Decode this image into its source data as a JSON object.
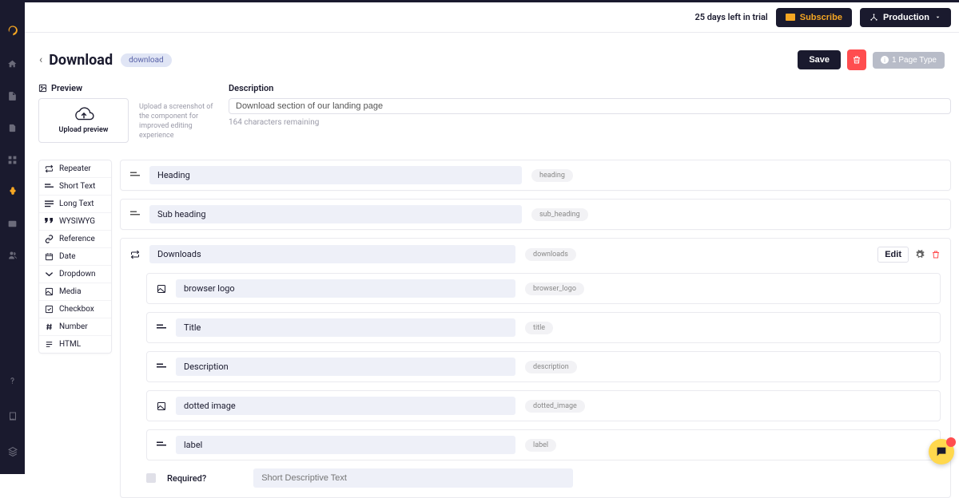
{
  "header": {
    "trial_text": "25 days left in trial",
    "subscribe_label": "Subscribe",
    "env_label": "Production"
  },
  "titlebar": {
    "title": "Download",
    "slug": "download",
    "save_label": "Save",
    "pagetype_label": "1 Page Type"
  },
  "preview": {
    "label": "Preview",
    "upload_text": "Upload preview",
    "hint": "Upload a screenshot of the component for improved editing experience"
  },
  "description_section": {
    "label": "Description",
    "value": "Download section of our landing page",
    "counter": "164 characters remaining"
  },
  "palette": {
    "items": [
      {
        "icon": "repeat",
        "label": "Repeater"
      },
      {
        "icon": "short-text",
        "label": "Short Text"
      },
      {
        "icon": "long-text",
        "label": "Long Text"
      },
      {
        "icon": "quote",
        "label": "WYSIWYG"
      },
      {
        "icon": "link",
        "label": "Reference"
      },
      {
        "icon": "calendar",
        "label": "Date"
      },
      {
        "icon": "chevron-down",
        "label": "Dropdown"
      },
      {
        "icon": "image",
        "label": "Media"
      },
      {
        "icon": "checkbox",
        "label": "Checkbox"
      },
      {
        "icon": "hash",
        "label": "Number"
      },
      {
        "icon": "html",
        "label": "HTML"
      }
    ]
  },
  "fields": {
    "heading": {
      "name": "Heading",
      "tag": "heading"
    },
    "sub_heading": {
      "name": "Sub heading",
      "tag": "sub_heading"
    },
    "downloads": {
      "name": "Downloads",
      "tag": "downloads",
      "edit_label": "Edit",
      "children": [
        {
          "icon": "image",
          "name": "browser logo",
          "tag": "browser_logo"
        },
        {
          "icon": "short-text",
          "name": "Title",
          "tag": "title"
        },
        {
          "icon": "short-text",
          "name": "Description",
          "tag": "description"
        },
        {
          "icon": "image",
          "name": "dotted image",
          "tag": "dotted_image"
        },
        {
          "icon": "short-text",
          "name": "label",
          "tag": "label"
        }
      ],
      "required_label": "Required?",
      "descriptive_placeholder": "Short Descriptive Text"
    }
  }
}
